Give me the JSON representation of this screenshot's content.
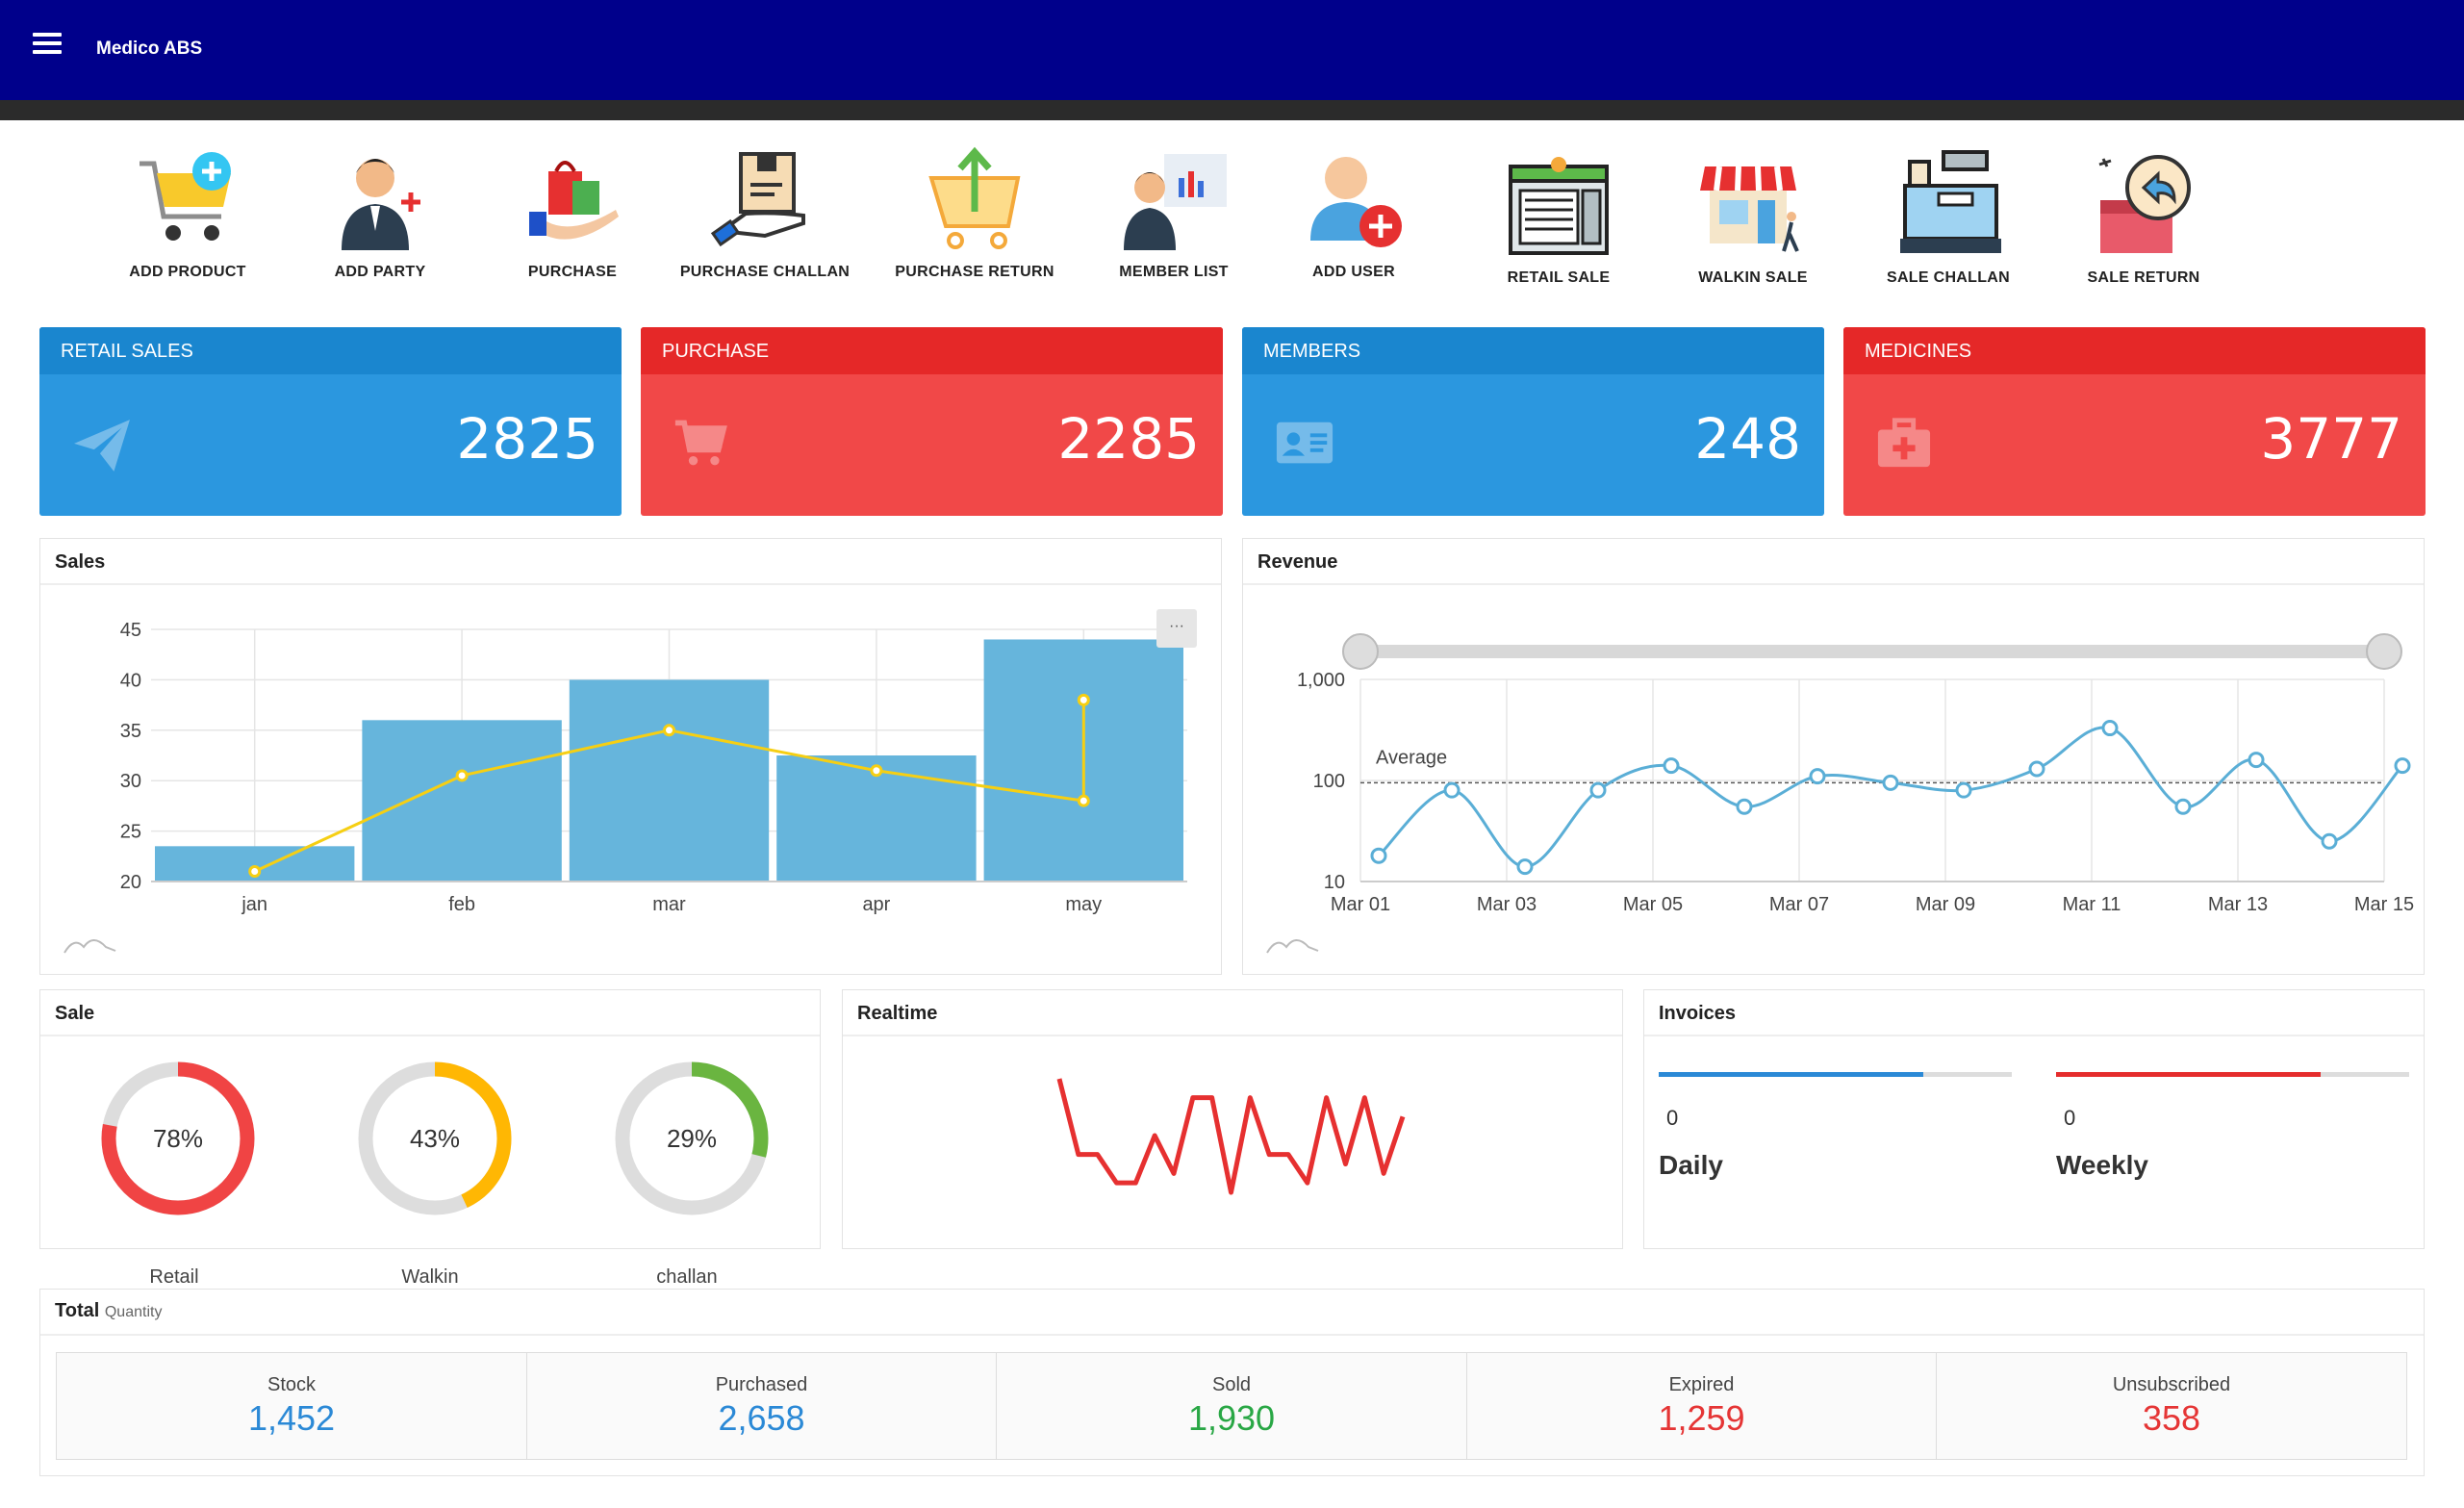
{
  "app": {
    "title": "Medico ABS"
  },
  "shortcuts": [
    {
      "label": "ADD PRODUCT",
      "icon": "add-product-icon"
    },
    {
      "label": "ADD PARTY",
      "icon": "add-party-icon"
    },
    {
      "label": "PURCHASE",
      "icon": "purchase-icon"
    },
    {
      "label": "PURCHASE CHALLAN",
      "icon": "purchase-challan-icon"
    },
    {
      "label": "PURCHASE RETURN",
      "icon": "purchase-return-icon"
    },
    {
      "label": "MEMBER LIST",
      "icon": "member-list-icon"
    },
    {
      "label": "ADD USER",
      "icon": "add-user-icon"
    },
    {
      "label": "RETAIL SALE",
      "icon": "retail-sale-icon"
    },
    {
      "label": "WALKIN SALE",
      "icon": "walkin-sale-icon"
    },
    {
      "label": "SALE CHALLAN",
      "icon": "sale-challan-icon"
    },
    {
      "label": "SALE RETURN",
      "icon": "sale-return-icon"
    }
  ],
  "stats": [
    {
      "title": "RETAIL SALES",
      "value": "2825",
      "color": "#2b97df",
      "icon": "paper-plane-icon"
    },
    {
      "title": "PURCHASE",
      "value": "2285",
      "color": "#f14848",
      "icon": "cart-icon"
    },
    {
      "title": "MEMBERS",
      "value": "248",
      "color": "#2b97df",
      "icon": "id-card-icon"
    },
    {
      "title": "MEDICINES",
      "value": "3777",
      "color": "#f14848",
      "icon": "medkit-icon"
    }
  ],
  "sales_panel": {
    "title": "Sales",
    "menu": "···"
  },
  "revenue_panel": {
    "title": "Revenue",
    "average_label": "Average"
  },
  "sale_panel": {
    "title": "Sale"
  },
  "realtime_panel": {
    "title": "Realtime"
  },
  "invoices_panel": {
    "title": "Invoices",
    "items": [
      {
        "label": "Daily",
        "value": "0",
        "progress": 0.75,
        "color": "#2b89d6"
      },
      {
        "label": "Weekly",
        "value": "0",
        "progress": 0.75,
        "color": "#e52d2d"
      }
    ]
  },
  "total_panel": {
    "title": "Total",
    "subtitle": "Quantity"
  },
  "quantities": [
    {
      "label": "Stock",
      "value": "1,452",
      "color": "#2b89d6"
    },
    {
      "label": "Purchased",
      "value": "2,658",
      "color": "#2b89d6"
    },
    {
      "label": "Sold",
      "value": "1,930",
      "color": "#29a745"
    },
    {
      "label": "Expired",
      "value": "1,259",
      "color": "#e53535"
    },
    {
      "label": "Unsubscribed",
      "value": "358",
      "color": "#e53535"
    }
  ],
  "chart_data": [
    {
      "type": "bar",
      "categories": [
        "jan",
        "feb",
        "mar",
        "apr",
        "may"
      ],
      "series": [
        {
          "type": "bar",
          "values": [
            23.5,
            36,
            40,
            32.5,
            44
          ],
          "color": "#66b5dc"
        },
        {
          "type": "line",
          "values": [
            21,
            30.5,
            35,
            31,
            28
          ],
          "extra_point": 38,
          "color": "#f6cf13"
        }
      ],
      "ylim": [
        20,
        45
      ],
      "yticks": [
        20,
        25,
        30,
        35,
        40,
        45
      ]
    },
    {
      "type": "line",
      "x": [
        "Mar 01",
        "Mar 02",
        "Mar 03",
        "Mar 04",
        "Mar 05",
        "Mar 06",
        "Mar 07",
        "Mar 08",
        "Mar 09",
        "Mar 10",
        "Mar 11",
        "Mar 12",
        "Mar 13",
        "Mar 14",
        "Mar 15"
      ],
      "xticks": [
        "Mar 01",
        "Mar 03",
        "Mar 05",
        "Mar 07",
        "Mar 09",
        "Mar 11",
        "Mar 13",
        "Mar 15"
      ],
      "values": [
        18,
        80,
        14,
        80,
        140,
        55,
        110,
        95,
        80,
        130,
        330,
        55,
        160,
        25,
        140
      ],
      "log_scale": true,
      "ylim": [
        10,
        1000
      ],
      "yticks": [
        "10",
        "100",
        "1,000"
      ],
      "average": 95,
      "color": "#5aaed6"
    },
    {
      "type": "pie",
      "items": [
        {
          "label": "Retail",
          "percent": 78,
          "text": "78%",
          "color": "#f04444"
        },
        {
          "label": "Walkin",
          "percent": 43,
          "text": "43%",
          "color": "#ffb703"
        },
        {
          "label": "challan",
          "percent": 29,
          "text": "29%",
          "color": "#6ab540"
        }
      ]
    },
    {
      "type": "line",
      "name": "Realtime",
      "values": [
        6,
        2,
        2,
        0.5,
        0.5,
        3,
        1,
        5,
        5,
        0,
        5,
        2,
        2,
        0.5,
        5,
        1.5,
        5,
        1,
        4
      ],
      "color": "#e63030"
    }
  ]
}
